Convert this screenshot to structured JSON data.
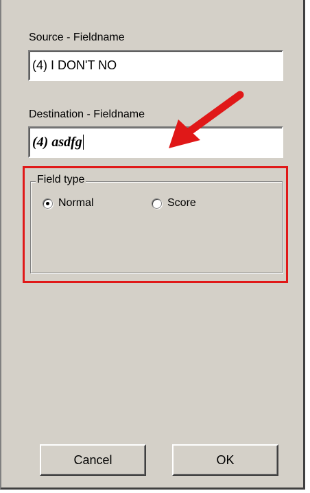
{
  "source": {
    "label": "Source - Fieldname",
    "value": "(4) I DON'T NO"
  },
  "destination": {
    "label": "Destination - Fieldname",
    "value": "(4) asdfg"
  },
  "field_type": {
    "legend": "Field type",
    "options": [
      {
        "label": "Normal",
        "checked": true
      },
      {
        "label": "Score",
        "checked": false
      }
    ]
  },
  "buttons": {
    "cancel_label": "Cancel",
    "ok_label": "OK"
  },
  "annotation": {
    "highlight_color": "#e01818",
    "arrow_color": "#e01818"
  }
}
